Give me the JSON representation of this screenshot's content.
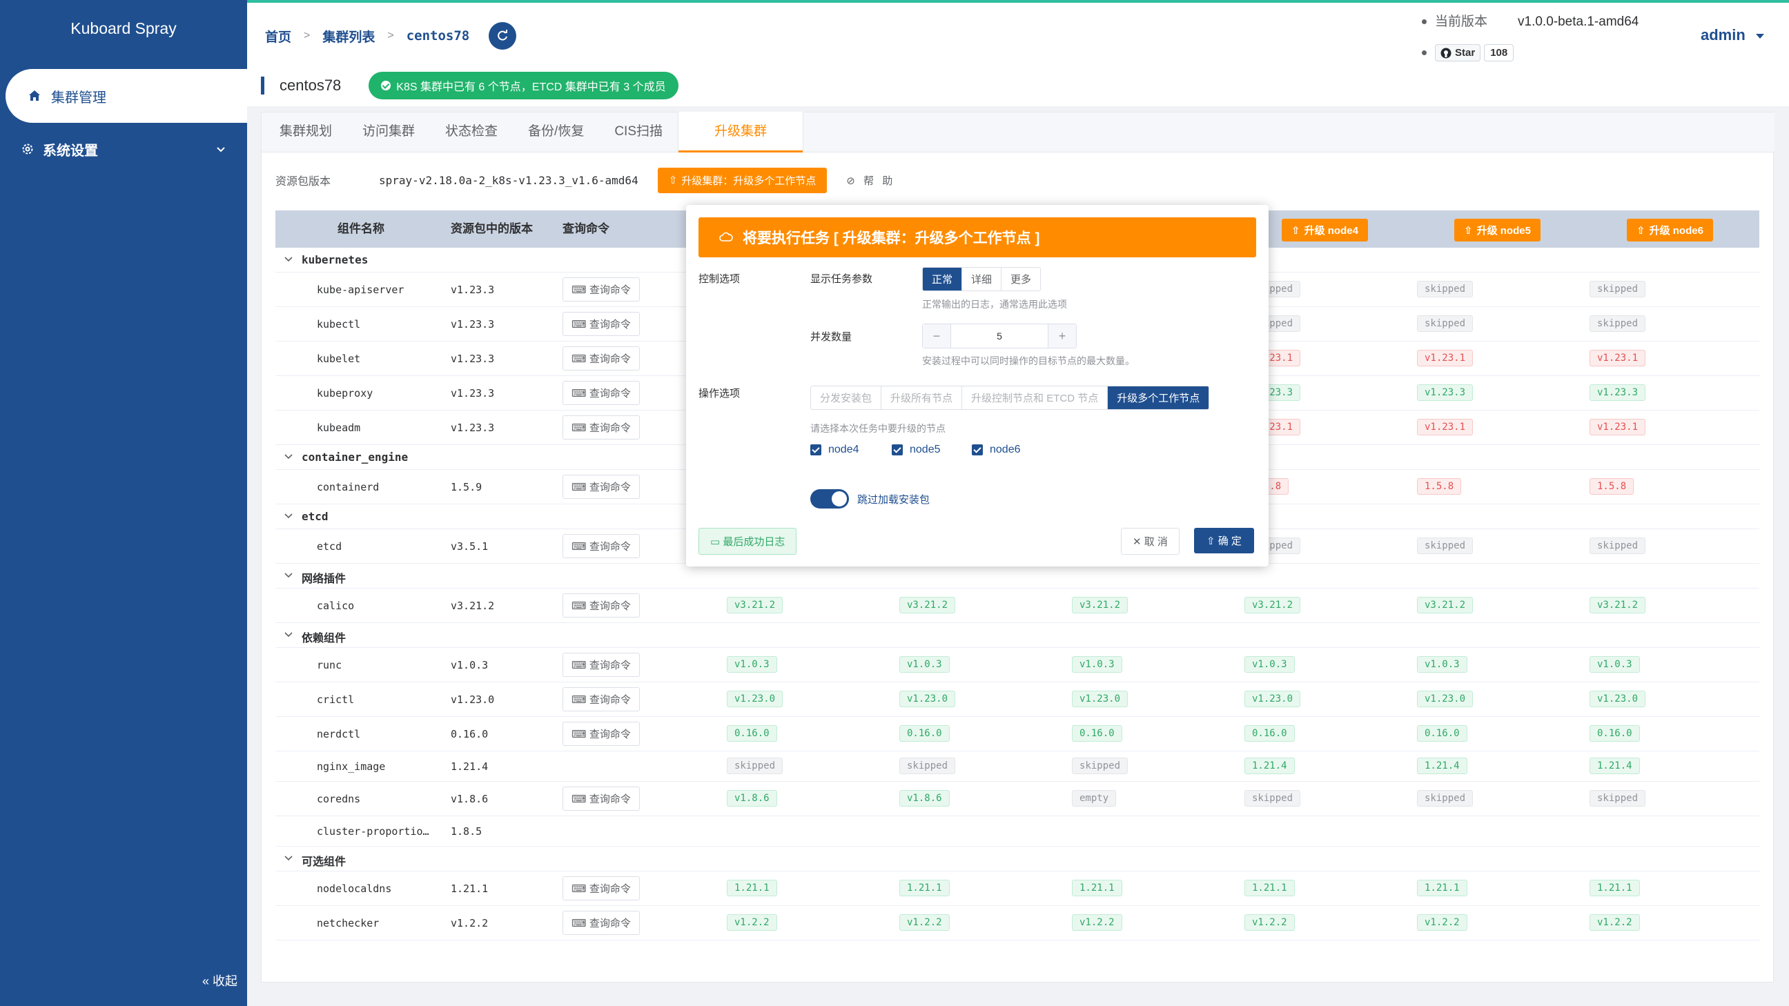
{
  "app": {
    "title": "Kuboard Spray"
  },
  "sidebar": {
    "items": [
      {
        "label": "集群管理",
        "icon": "home-icon"
      },
      {
        "label": "系统设置",
        "icon": "gear-icon"
      }
    ],
    "collapse_label": "« 收起"
  },
  "header": {
    "breadcrumbs": [
      "首页",
      "集群列表",
      "centos78"
    ],
    "version_label": "当前版本",
    "version": "v1.0.0-beta.1-amd64",
    "star_label": "Star",
    "star_count": "108",
    "user": "admin"
  },
  "cluster": {
    "name": "centos78",
    "status": "K8S 集群中已有 6 个节点，ETCD 集群中已有 3 个成员"
  },
  "tabs": [
    "集群规划",
    "访问集群",
    "状态检查",
    "备份/恢复",
    "CIS扫描",
    "升级集群"
  ],
  "package": {
    "label": "资源包版本",
    "value": "spray-v2.18.0a-2_k8s-v1.23.3_v1.6-amd64",
    "action": "升级集群：升级多个工作节点",
    "help": "帮 助"
  },
  "table": {
    "headers": [
      "组件名称",
      "资源包中的版本",
      "查询命令"
    ],
    "node_buttons": [
      "升级 node4",
      "升级 node5",
      "升级 node6"
    ],
    "query_label": "查询命令",
    "rows": [
      {
        "type": "group",
        "name": "kubernetes"
      },
      {
        "type": "item",
        "name": "kube-apiserver",
        "version": "v1.23.3",
        "query": true,
        "cells": [
          [
            "skipped",
            "gray"
          ],
          [
            "skipped",
            "gray"
          ],
          [
            "skipped",
            "gray"
          ]
        ]
      },
      {
        "type": "item",
        "name": "kubectl",
        "version": "v1.23.3",
        "query": true,
        "cells": [
          [
            "skipped",
            "gray"
          ],
          [
            "skipped",
            "gray"
          ],
          [
            "skipped",
            "gray"
          ]
        ]
      },
      {
        "type": "item",
        "name": "kubelet",
        "version": "v1.23.3",
        "query": true,
        "cells": [
          [
            "v1.23.1",
            "red"
          ],
          [
            "v1.23.1",
            "red"
          ],
          [
            "v1.23.1",
            "red"
          ]
        ]
      },
      {
        "type": "item",
        "name": "kubeproxy",
        "version": "v1.23.3",
        "query": true,
        "cells": [
          [
            "v1.23.3",
            "green"
          ],
          [
            "v1.23.3",
            "green"
          ],
          [
            "v1.23.3",
            "green"
          ]
        ]
      },
      {
        "type": "item",
        "name": "kubeadm",
        "version": "v1.23.3",
        "query": true,
        "cells": [
          [
            "v1.23.1",
            "red"
          ],
          [
            "v1.23.1",
            "red"
          ],
          [
            "v1.23.1",
            "red"
          ]
        ]
      },
      {
        "type": "group",
        "name": "container_engine"
      },
      {
        "type": "item",
        "name": "containerd",
        "version": "1.5.9",
        "query": true,
        "cells": [
          [
            "1.5.8",
            "red"
          ],
          [
            "1.5.8",
            "red"
          ],
          [
            "1.5.8",
            "red"
          ]
        ]
      },
      {
        "type": "group",
        "name": "etcd"
      },
      {
        "type": "item",
        "name": "etcd",
        "version": "v3.5.1",
        "query": true,
        "cells": [
          [
            "skipped",
            "gray"
          ],
          [
            "skipped",
            "gray"
          ],
          [
            "skipped",
            "gray"
          ]
        ]
      },
      {
        "type": "group",
        "name": "网络插件"
      },
      {
        "type": "item",
        "name": "calico",
        "version": "v3.21.2",
        "query": true,
        "cells": [
          [
            "v3.21.2",
            "green"
          ],
          [
            "v3.21.2",
            "green"
          ],
          [
            "v3.21.2",
            "green"
          ],
          [
            "v3.21.2",
            "green"
          ],
          [
            "v3.21.2",
            "green"
          ],
          [
            "v3.21.2",
            "green"
          ]
        ]
      },
      {
        "type": "group",
        "name": "依赖组件"
      },
      {
        "type": "item",
        "name": "runc",
        "version": "v1.0.3",
        "query": true,
        "cells": [
          [
            "v1.0.3",
            "green"
          ],
          [
            "v1.0.3",
            "green"
          ],
          [
            "v1.0.3",
            "green"
          ],
          [
            "v1.0.3",
            "green"
          ],
          [
            "v1.0.3",
            "green"
          ],
          [
            "v1.0.3",
            "green"
          ]
        ]
      },
      {
        "type": "item",
        "name": "crictl",
        "version": "v1.23.0",
        "query": true,
        "cells": [
          [
            "v1.23.0",
            "green"
          ],
          [
            "v1.23.0",
            "green"
          ],
          [
            "v1.23.0",
            "green"
          ],
          [
            "v1.23.0",
            "green"
          ],
          [
            "v1.23.0",
            "green"
          ],
          [
            "v1.23.0",
            "green"
          ]
        ]
      },
      {
        "type": "item",
        "name": "nerdctl",
        "version": "0.16.0",
        "query": true,
        "cells": [
          [
            "0.16.0",
            "green"
          ],
          [
            "0.16.0",
            "green"
          ],
          [
            "0.16.0",
            "green"
          ],
          [
            "0.16.0",
            "green"
          ],
          [
            "0.16.0",
            "green"
          ],
          [
            "0.16.0",
            "green"
          ]
        ]
      },
      {
        "type": "item",
        "name": "nginx_image",
        "version": "1.21.4",
        "query": false,
        "cells": [
          [
            "skipped",
            "gray"
          ],
          [
            "skipped",
            "gray"
          ],
          [
            "skipped",
            "gray"
          ],
          [
            "1.21.4",
            "green"
          ],
          [
            "1.21.4",
            "green"
          ],
          [
            "1.21.4",
            "green"
          ]
        ]
      },
      {
        "type": "item",
        "name": "coredns",
        "version": "v1.8.6",
        "query": true,
        "cells": [
          [
            "v1.8.6",
            "green"
          ],
          [
            "v1.8.6",
            "green"
          ],
          [
            "empty",
            "gray"
          ],
          [
            "skipped",
            "gray"
          ],
          [
            "skipped",
            "gray"
          ],
          [
            "skipped",
            "gray"
          ]
        ]
      },
      {
        "type": "item",
        "name": "cluster-proportio…",
        "version": "1.8.5",
        "query": false,
        "cells": []
      },
      {
        "type": "group",
        "name": "可选组件"
      },
      {
        "type": "item",
        "name": "nodelocaldns",
        "version": "1.21.1",
        "query": true,
        "cells": [
          [
            "1.21.1",
            "green"
          ],
          [
            "1.21.1",
            "green"
          ],
          [
            "1.21.1",
            "green"
          ],
          [
            "1.21.1",
            "green"
          ],
          [
            "1.21.1",
            "green"
          ],
          [
            "1.21.1",
            "green"
          ]
        ]
      },
      {
        "type": "item",
        "name": "netchecker",
        "version": "v1.2.2",
        "query": true,
        "cells": [
          [
            "v1.2.2",
            "green"
          ],
          [
            "v1.2.2",
            "green"
          ],
          [
            "v1.2.2",
            "green"
          ],
          [
            "v1.2.2",
            "green"
          ],
          [
            "v1.2.2",
            "green"
          ],
          [
            "v1.2.2",
            "green"
          ]
        ]
      }
    ]
  },
  "modal": {
    "title": "将要执行任务 [ 升级集群：升级多个工作节点 ]",
    "control_label": "控制选项",
    "show_params_label": "显示任务参数",
    "verbosity": {
      "options": [
        "正常",
        "详细",
        "更多"
      ],
      "selected": "正常"
    },
    "verbosity_hint": "正常输出的日志，通常选用此选项",
    "parallel_label": "并发数量",
    "parallel_value": "5",
    "parallel_hint": "安装过程中可以同时操作的目标节点的最大数量。",
    "op_label": "操作选项",
    "operations": {
      "options": [
        "分发安装包",
        "升级所有节点",
        "升级控制节点和 ETCD 节点",
        "升级多个工作节点"
      ],
      "selected": "升级多个工作节点"
    },
    "select_hint": "请选择本次任务中要升级的节点",
    "nodes": [
      {
        "label": "node4",
        "checked": true
      },
      {
        "label": "node5",
        "checked": true
      },
      {
        "label": "node6",
        "checked": true
      }
    ],
    "skip_label": "跳过加载安装包",
    "skip_on": true,
    "last_log": "最后成功日志",
    "cancel": "取 消",
    "confirm": "确 定"
  },
  "colors": {
    "primary": "#1f4f8f",
    "accent": "#ff8c00",
    "success": "#20b36b"
  }
}
